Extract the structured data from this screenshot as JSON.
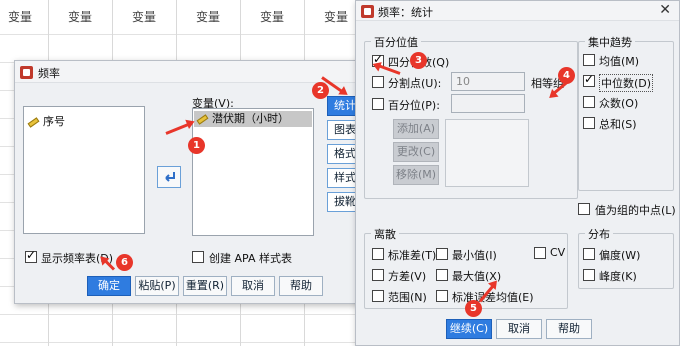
{
  "spreadsheet": {
    "column_header": "变量"
  },
  "freq_dialog": {
    "title": "频率",
    "source_vars": [
      {
        "label": "序号"
      }
    ],
    "target_label": "变量(V):",
    "target_vars": [
      {
        "label": "潜伏期（小时）"
      }
    ],
    "side_buttons": [
      "统计",
      "图表",
      "格式",
      "样式",
      "拔靴法"
    ],
    "show_freq_table": "显示频率表(D)",
    "apa_table": "创建 APA 样式表",
    "buttons": {
      "ok": "确定",
      "paste": "粘贴(P)",
      "reset": "重置(R)",
      "cancel": "取消",
      "help": "帮助"
    }
  },
  "stats_dialog": {
    "title": "频率：统计",
    "percentile": {
      "title": "百分位值",
      "quartiles": "四分位数(Q)",
      "cut_points": "分割点(U):",
      "cut_value": "10",
      "equal_groups": "相等组",
      "percentiles": "百分位(P):",
      "add": "添加(A)",
      "change": "更改(C)",
      "remove": "移除(M)"
    },
    "central": {
      "title": "集中趋势",
      "mean": "均值(M)",
      "median": "中位数(D)",
      "mode": "众数(O)",
      "sum": "总和(S)"
    },
    "midpoints": "值为组的中点(L)",
    "dispersion": {
      "title": "离散",
      "std": "标准差(T)",
      "min": "最小值(I)",
      "variance": "方差(V)",
      "max": "最大值(X)",
      "range": "范围(N)",
      "sem": "标准误差均值(E)"
    },
    "distribution": {
      "title": "分布",
      "skewness": "偏度(W)",
      "kurtosis": "峰度(K)"
    },
    "buttons": {
      "continue": "继续(C)",
      "cancel": "取消",
      "help": "帮助"
    }
  },
  "annotations": [
    "1",
    "2",
    "3",
    "4",
    "5",
    "6"
  ],
  "colors": {
    "accent": "#2f7ce0",
    "marker": "#e8362a"
  }
}
